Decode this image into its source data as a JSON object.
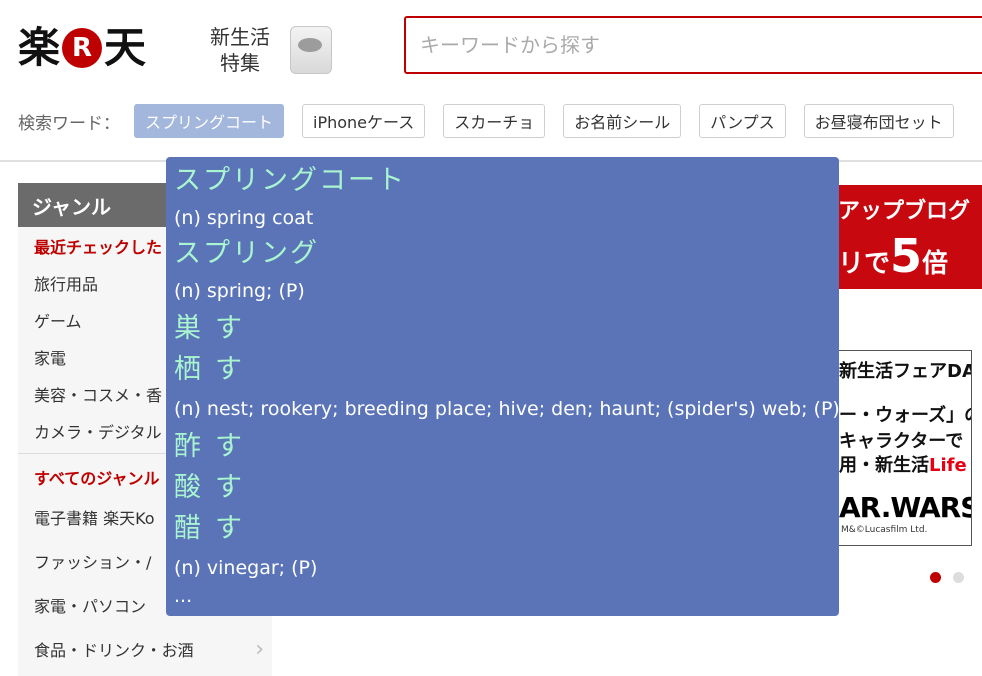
{
  "header": {
    "logo": {
      "left": "楽",
      "mark": "R",
      "right": "天"
    },
    "promo": {
      "line1": "新生活",
      "line2": "特集",
      "image": "washing-machine-icon"
    },
    "search": {
      "placeholder": "キーワードから探す",
      "value": ""
    },
    "keywords_label": "検索ワード：",
    "keywords": [
      {
        "label": "スプリングコート",
        "selected": true
      },
      {
        "label": "iPhoneケース",
        "selected": false
      },
      {
        "label": "スカーチョ",
        "selected": false
      },
      {
        "label": "お名前シール",
        "selected": false
      },
      {
        "label": "パンプス",
        "selected": false
      },
      {
        "label": "お昼寝布団セット",
        "selected": false
      }
    ]
  },
  "sidebar": {
    "title": "ジャンル",
    "recent_label": "最近チェックした",
    "recent_items": [
      "旅行用品",
      "ゲーム",
      "家電",
      "美容・コスメ・香",
      "カメラ・デジタル"
    ],
    "all_label": "すべてのジャンル",
    "all_items": [
      "電子書籍 楽天Ko",
      "ファッション・/",
      "家電・パソコン",
      "食品・ドリンク・お酒"
    ],
    "chevron": "›"
  },
  "banners": {
    "banner1": {
      "line1": "アップブログ",
      "line2_pre": "リで",
      "line2_big": "5",
      "line2_post": "倍"
    },
    "banner2": {
      "line1": "新生活フェアDAY",
      "line2": "ー・ウォーズ」の",
      "line3": "キャラクターで",
      "line4_pre": "用・新生活",
      "line4_red": "Life",
      "logo": "AR.WARS",
      "copyright": "M&©Lucasfilm Ltd."
    },
    "carousel_dots": 2,
    "carousel_active": 0
  },
  "popup": {
    "entries": [
      {
        "word": "スプリングコート",
        "gloss": "(n) spring coat",
        "kanji": false
      },
      {
        "word": "スプリング",
        "gloss": "(n) spring; (P)",
        "kanji": false
      },
      {
        "word": "巣す",
        "gloss": "",
        "kanji": true
      },
      {
        "word": "栖す",
        "gloss": "(n) nest; rookery; breeding place; hive; den; haunt; (spider's) web; (P)",
        "kanji": true
      },
      {
        "word": "酢す",
        "gloss": "",
        "kanji": true
      },
      {
        "word": "酸す",
        "gloss": "",
        "kanji": true
      },
      {
        "word": "醋す",
        "gloss": "(n) vinegar; (P)",
        "kanji": true
      }
    ],
    "more": "..."
  },
  "colors": {
    "brand": "#bf0000",
    "popup_bg": "#5b74b8",
    "popup_word": "#a8f5cf",
    "selected_tag": "#a3b6dc"
  }
}
